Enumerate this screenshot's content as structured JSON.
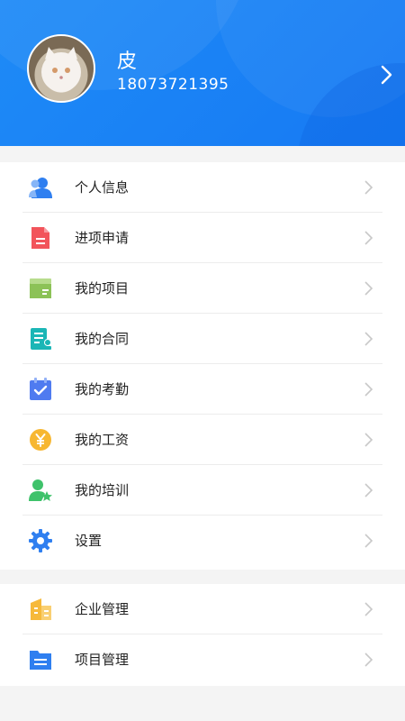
{
  "profile": {
    "name": "皮",
    "phone": "18073721395"
  },
  "menu_main": [
    {
      "label": "个人信息",
      "icon": "user-icon",
      "color": "#2f7ff0"
    },
    {
      "label": "进项申请",
      "icon": "document-icon",
      "color": "#f2545b"
    },
    {
      "label": "我的项目",
      "icon": "folder-icon",
      "color": "#8cc257"
    },
    {
      "label": "我的合同",
      "icon": "contract-icon",
      "color": "#1bb6b6"
    },
    {
      "label": "我的考勤",
      "icon": "calendar-check-icon",
      "color": "#4f7bf0"
    },
    {
      "label": "我的工资",
      "icon": "yen-coin-icon",
      "color": "#f7b731"
    },
    {
      "label": "我的培训",
      "icon": "user-star-icon",
      "color": "#3fc26b"
    },
    {
      "label": "设置",
      "icon": "gear-icon",
      "color": "#2f7ff0"
    }
  ],
  "menu_manage": [
    {
      "label": "企业管理",
      "icon": "building-icon",
      "color": "#f6b93b"
    },
    {
      "label": "项目管理",
      "icon": "file-list-icon",
      "color": "#2f7ff0"
    }
  ],
  "colors": {
    "header": "#1e8bf7",
    "background": "#f4f4f4",
    "chevron": "#c8c8c8"
  }
}
